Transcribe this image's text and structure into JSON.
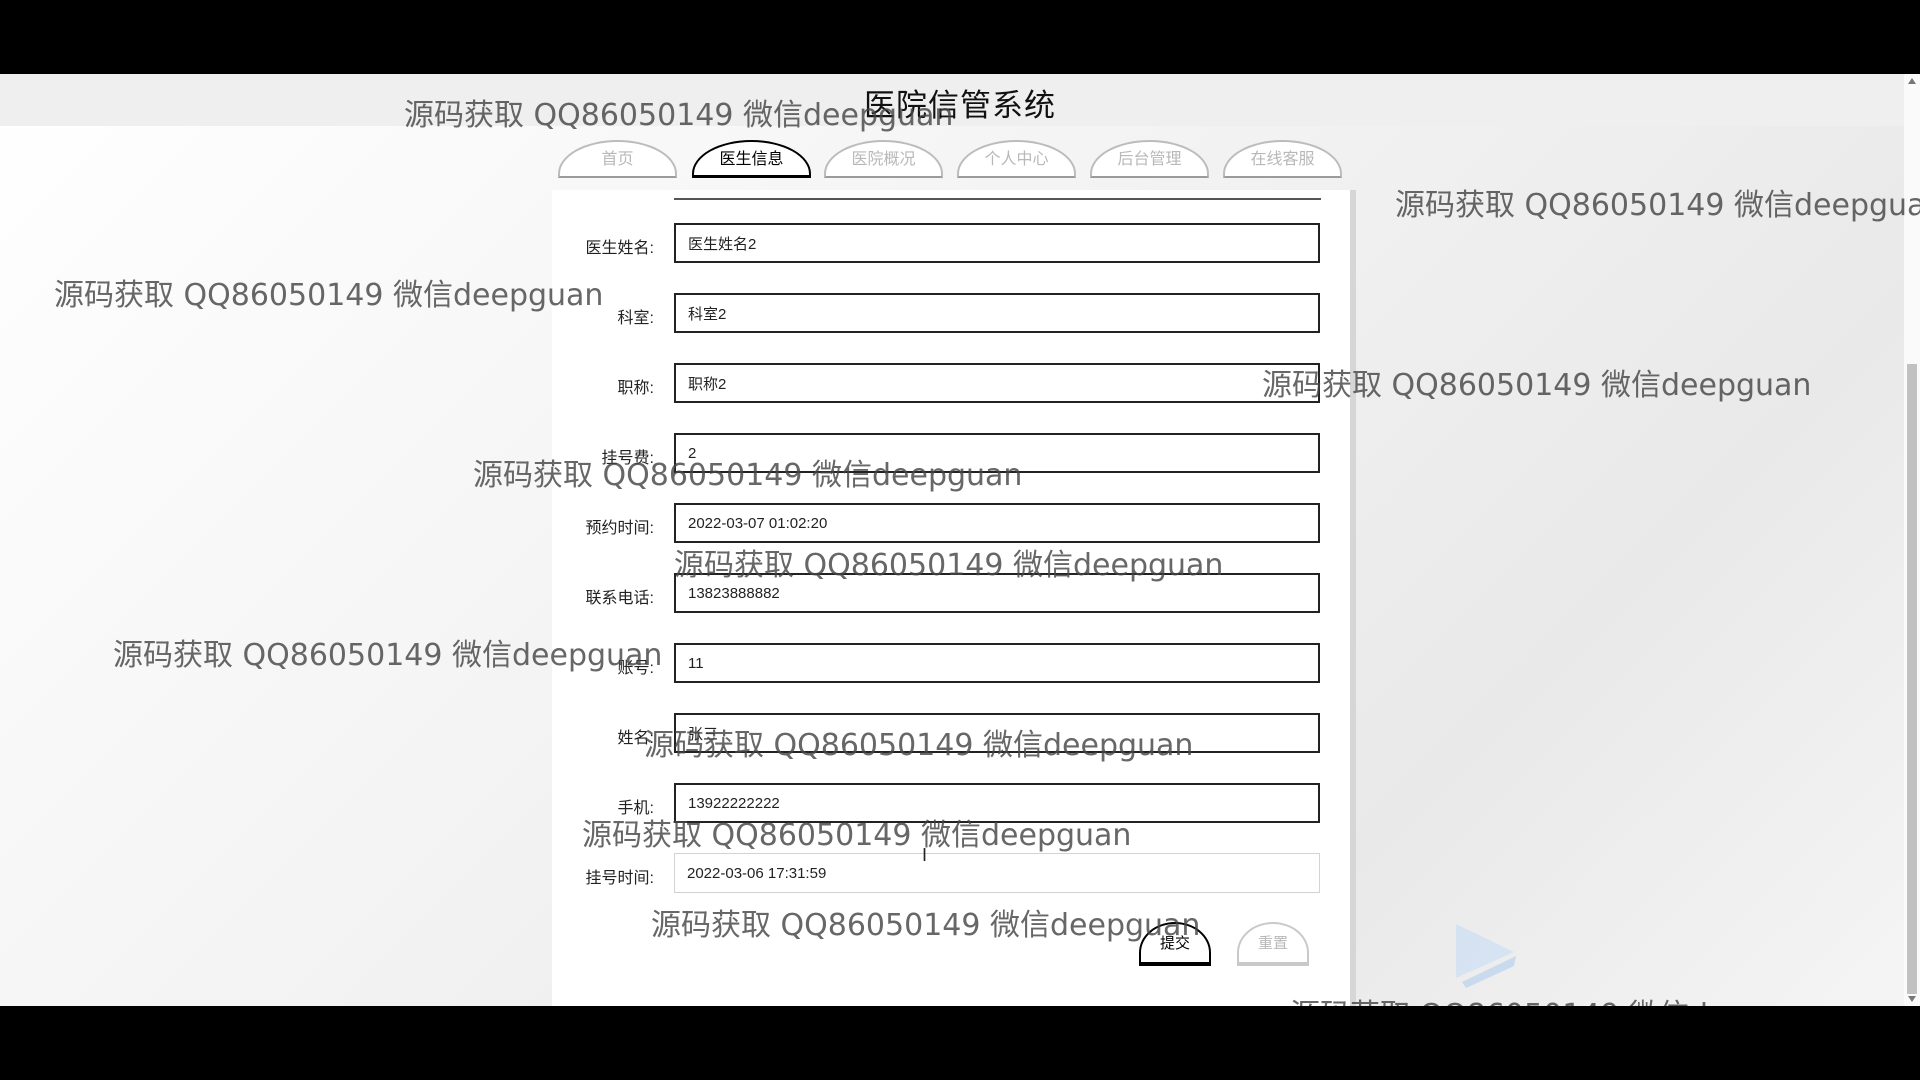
{
  "site": {
    "title": "医院信管系统"
  },
  "nav": {
    "tabs": [
      {
        "label": "首页",
        "active": false
      },
      {
        "label": "医生信息",
        "active": true
      },
      {
        "label": "医院概况",
        "active": false
      },
      {
        "label": "个人中心",
        "active": false
      },
      {
        "label": "后台管理",
        "active": false
      },
      {
        "label": "在线客服",
        "active": false
      }
    ]
  },
  "form": {
    "doctor_name": {
      "label": "医生姓名:",
      "value": "医生姓名2"
    },
    "department": {
      "label": "科室:",
      "value": "科室2"
    },
    "title": {
      "label": "职称:",
      "value": "职称2"
    },
    "fee": {
      "label": "挂号费:",
      "value": "2"
    },
    "appointment_time": {
      "label": "预约时间:",
      "value": "2022-03-07 01:02:20"
    },
    "contact_phone": {
      "label": "联系电话:",
      "value": "13823888882"
    },
    "account": {
      "label": "账号:",
      "value": "11"
    },
    "name": {
      "label": "姓名:",
      "value": "张三"
    },
    "mobile": {
      "label": "手机:",
      "value": "13922222222"
    },
    "register_time": {
      "label": "挂号时间:",
      "value": "2022-03-06 17:31:59"
    }
  },
  "buttons": {
    "submit": "提交",
    "reset": "重置"
  },
  "watermark": "源码获取 QQ86050149 微信deepguan",
  "colors": {
    "active_border": "#000000",
    "inactive_text": "#b8b8b8",
    "background": "#f0f0f0"
  }
}
